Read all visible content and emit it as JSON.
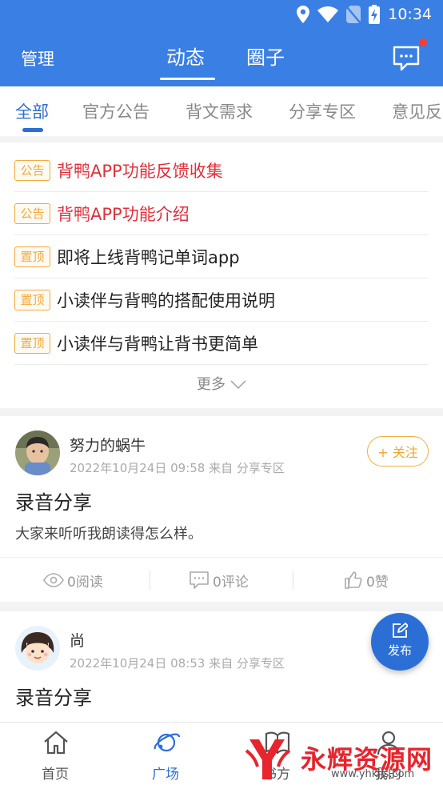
{
  "status_bar": {
    "time": "10:34"
  },
  "header": {
    "manage_label": "管理",
    "tabs": [
      {
        "label": "动态",
        "active": true
      },
      {
        "label": "圈子",
        "active": false
      }
    ],
    "notification_dot_color": "#ff3b30"
  },
  "categories": [
    {
      "label": "全部",
      "active": true
    },
    {
      "label": "官方公告",
      "active": false
    },
    {
      "label": "背文需求",
      "active": false
    },
    {
      "label": "分享专区",
      "active": false
    },
    {
      "label": "意见反",
      "active": false
    }
  ],
  "notices": [
    {
      "tag": "公告",
      "text": "背鸭APP功能反馈收集",
      "highlight": true
    },
    {
      "tag": "公告",
      "text": "背鸭APP功能介绍",
      "highlight": true
    },
    {
      "tag": "置顶",
      "text": "即将上线背鸭记单词app",
      "highlight": false
    },
    {
      "tag": "置顶",
      "text": "小读伴与背鸭的搭配使用说明",
      "highlight": false
    },
    {
      "tag": "置顶",
      "text": "小读伴与背鸭让背书更简单",
      "highlight": false
    }
  ],
  "more_label": "更多",
  "posts": [
    {
      "author": "努力的蜗牛",
      "meta": "2022年10月24日 09:58 来自 分享专区",
      "follow_label": "+ 关注",
      "title": "录音分享",
      "body": "大家来听听我朗读得怎么样。",
      "reads": "0阅读",
      "comments": "0评论",
      "likes": "0赞"
    },
    {
      "author": "尚",
      "meta": "2022年10月24日 08:53 来自 分享专区",
      "title": "录音分享"
    }
  ],
  "fab_label": "发布",
  "bottom_nav": [
    {
      "label": "首页",
      "icon": "home-icon",
      "active": false
    },
    {
      "label": "广场",
      "icon": "planet-icon",
      "active": true
    },
    {
      "label": "书方",
      "icon": "book-icon",
      "active": false
    },
    {
      "label": "我的",
      "icon": "person-icon",
      "active": false
    }
  ],
  "watermark": {
    "text": "永辉资源网",
    "url": "www.yhkjjs.com"
  },
  "colors": {
    "primary": "#3a7fe3",
    "accent": "#2b6fd6",
    "tag_orange": "#f3a93c",
    "highlight_red": "#e0303a"
  }
}
